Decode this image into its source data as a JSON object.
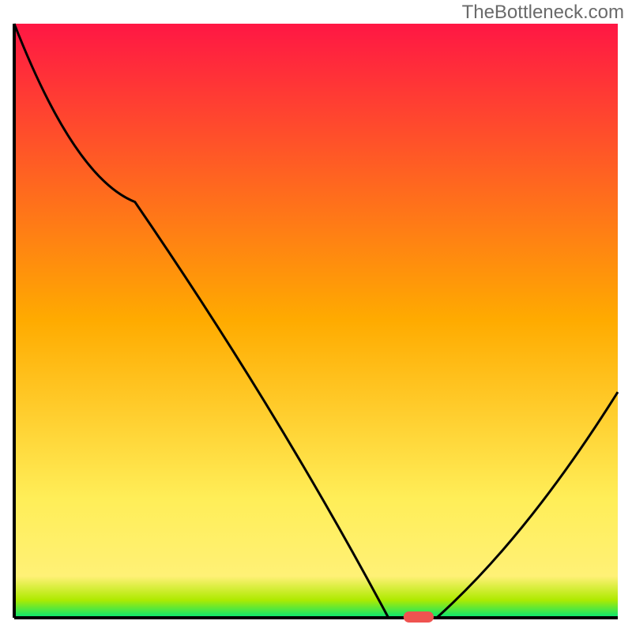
{
  "watermark": "TheBottleneck.com",
  "chart_data": {
    "type": "line",
    "title": "",
    "xlabel": "",
    "ylabel": "",
    "xlim": [
      0,
      100
    ],
    "ylim": [
      0,
      100
    ],
    "background_gradient": {
      "stops": [
        {
          "offset": 0,
          "color": "#ff1744"
        },
        {
          "offset": 50,
          "color": "#ffab00"
        },
        {
          "offset": 80,
          "color": "#ffee58"
        },
        {
          "offset": 93,
          "color": "#fff176"
        },
        {
          "offset": 97,
          "color": "#aeea00"
        },
        {
          "offset": 100,
          "color": "#00e676"
        }
      ]
    },
    "curve": [
      {
        "x": 0,
        "y": 100
      },
      {
        "x": 20,
        "y": 70
      },
      {
        "x": 62,
        "y": 0
      },
      {
        "x": 70,
        "y": 0
      },
      {
        "x": 100,
        "y": 38
      }
    ],
    "marker": {
      "x": 67,
      "y": 0,
      "width": 5,
      "color": "#ef5350"
    }
  }
}
